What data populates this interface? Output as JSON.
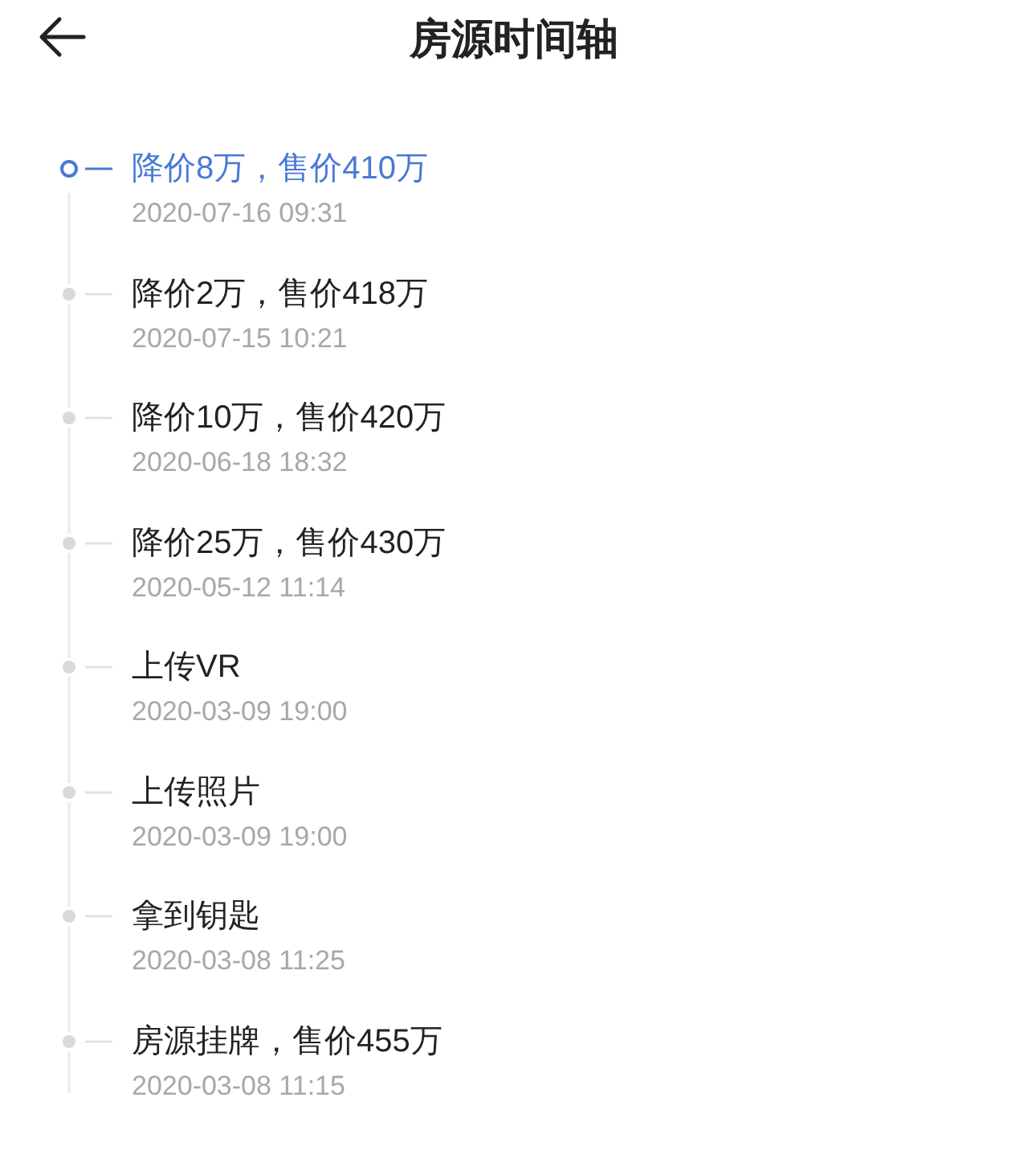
{
  "header": {
    "title": "房源时间轴"
  },
  "timeline": [
    {
      "title": "降价8万，售价410万",
      "time": "2020-07-16 09:31",
      "selected": true
    },
    {
      "title": "降价2万，售价418万",
      "time": "2020-07-15 10:21",
      "selected": false
    },
    {
      "title": "降价10万，售价420万",
      "time": "2020-06-18 18:32",
      "selected": false
    },
    {
      "title": "降价25万，售价430万",
      "time": "2020-05-12 11:14",
      "selected": false
    },
    {
      "title": "上传VR",
      "time": "2020-03-09 19:00",
      "selected": false
    },
    {
      "title": "上传照片",
      "time": "2020-03-09 19:00",
      "selected": false
    },
    {
      "title": "拿到钥匙",
      "time": "2020-03-08 11:25",
      "selected": false
    },
    {
      "title": "房源挂牌，售价455万",
      "time": "2020-03-08 11:15",
      "selected": false
    }
  ]
}
